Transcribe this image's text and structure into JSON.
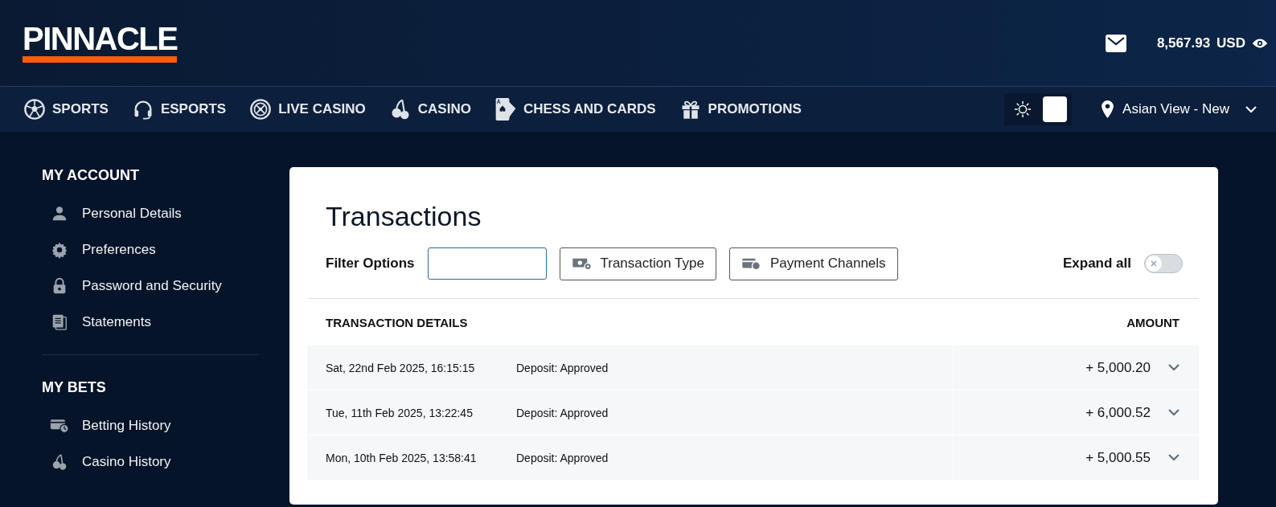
{
  "header": {
    "logo": "PINNACLE",
    "balance": "8,567.93",
    "currency": "USD"
  },
  "nav": [
    {
      "label": "SPORTS",
      "kind": "ball"
    },
    {
      "label": "ESPORTS",
      "kind": "headset"
    },
    {
      "label": "LIVE CASINO",
      "kind": "roulette"
    },
    {
      "label": "CASINO",
      "kind": "cherries"
    },
    {
      "label": "CHESS AND CARDS",
      "kind": "cards"
    },
    {
      "label": "PROMOTIONS",
      "kind": "gift"
    }
  ],
  "theme_switch": {
    "light": true
  },
  "view_selector": {
    "label": "Asian View - New"
  },
  "sidebar": [
    {
      "title": "MY ACCOUNT",
      "items": [
        {
          "label": "Personal Details",
          "kind": "person"
        },
        {
          "label": "Preferences",
          "kind": "gear"
        },
        {
          "label": "Password and Security",
          "kind": "lock"
        },
        {
          "label": "Statements",
          "kind": "document"
        }
      ]
    },
    {
      "title": "MY BETS",
      "items": [
        {
          "label": "Betting History",
          "kind": "ticket"
        },
        {
          "label": "Casino History",
          "kind": "cherries"
        }
      ]
    }
  ],
  "transactions": {
    "title": "Transactions",
    "filter_label": "Filter Options",
    "filter_buttons": [
      {
        "label": "Transaction Type",
        "kind": "money"
      },
      {
        "label": "Payment Channels",
        "kind": "card"
      }
    ],
    "expand_all": {
      "label": "Expand all",
      "on": false
    },
    "columns": [
      "TRANSACTION DETAILS",
      "AMOUNT"
    ],
    "rows": [
      {
        "date": "Sat, 22nd Feb 2025, 16:15:15",
        "description": "Deposit: Approved",
        "amount": "+ 5,000.20",
        "expanded": false
      },
      {
        "date": "Tue, 11th Feb 2025, 13:22:45",
        "description": "Deposit: Approved",
        "amount": "+ 6,000.52",
        "expanded": false
      },
      {
        "date": "Mon, 10th Feb 2025, 13:58:41",
        "description": "Deposit: Approved",
        "amount": "+ 5,000.55",
        "expanded": false
      }
    ]
  }
}
